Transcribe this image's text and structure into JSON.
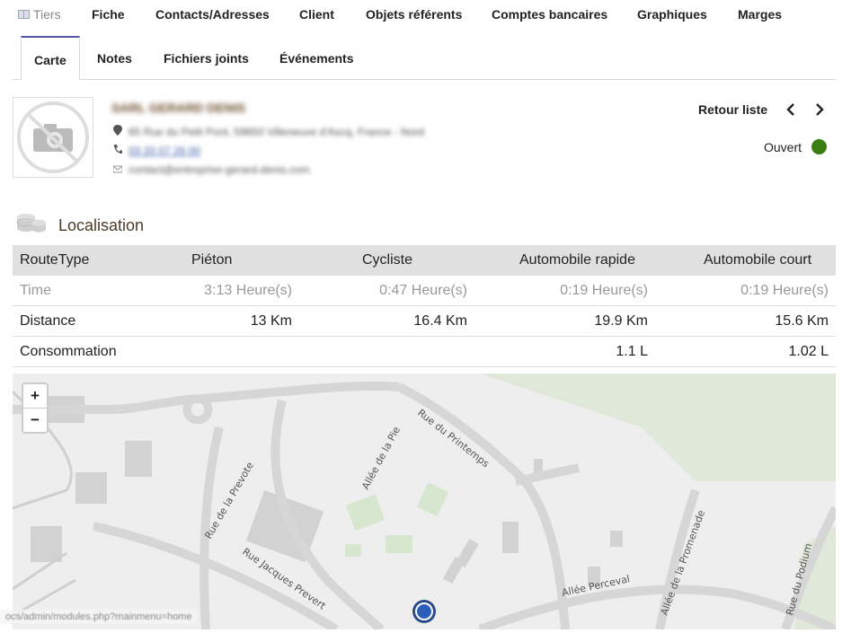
{
  "top_tabs": [
    "Tiers",
    "Fiche",
    "Contacts/Adresses",
    "Client",
    "Objets référents",
    "Comptes bancaires",
    "Graphiques",
    "Marges"
  ],
  "sub_tabs": [
    "Carte",
    "Notes",
    "Fichiers joints",
    "Événements"
  ],
  "header": {
    "company_name": "SARL GERARD DENIS",
    "address": "65 Rue du Petit Pont, 59650 Villeneuve d'Ascq, France - Nord",
    "phone": "03 20 07 26 00",
    "email": "contact@entreprise-gerard-denis.com",
    "back_label": "Retour liste",
    "status_label": "Ouvert",
    "status_color": "#3a7d10"
  },
  "section": {
    "title": "Localisation"
  },
  "table": {
    "headers": [
      "RouteType",
      "Piéton",
      "Cycliste",
      "Automobile rapide",
      "Automobile court"
    ],
    "rows": [
      {
        "label": "Time",
        "values": [
          "3:13 Heure(s)",
          "0:47 Heure(s)",
          "0:19 Heure(s)",
          "0:19 Heure(s)"
        ]
      },
      {
        "label": "Distance",
        "values": [
          "13 Km",
          "16.4 Km",
          "19.9 Km",
          "15.6 Km"
        ]
      },
      {
        "label": "Consommation",
        "values": [
          "",
          "",
          "1.1 L",
          "1.02 L"
        ]
      }
    ]
  },
  "map": {
    "zoom_in": "+",
    "zoom_out": "−",
    "streets": [
      "Rue du Printemps",
      "Allée de la Pie",
      "Rue de la Prevote",
      "Rue Jacques Prevert",
      "Allée Perceval",
      "Allée de la Promenade",
      "Rue du Podium"
    ]
  },
  "status_url": "ocs/admin/modules.php?mainmenu=home"
}
